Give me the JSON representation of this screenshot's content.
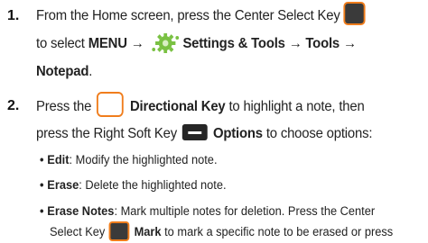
{
  "steps": [
    {
      "number": "1.",
      "line1_text": "From the Home screen, press the Center Select Key",
      "line2_pre": "to select ",
      "menu": "MENU",
      "arrow": "→",
      "settings_tools": "Settings & Tools",
      "tools": "Tools",
      "notepad": "Notepad",
      "period": "."
    },
    {
      "number": "2.",
      "press_the": "Press the",
      "directional_key": "Directional Key",
      "to_highlight": " to highlight a note, then",
      "press_right_soft_key": "press the Right Soft Key",
      "options": "Options",
      "to_choose": " to choose options:"
    }
  ],
  "bullets": [
    {
      "term": "Edit",
      "desc": ": Modify the highlighted note."
    },
    {
      "term": "Erase",
      "desc": ": Delete the highlighted note."
    },
    {
      "term": "Erase Notes",
      "desc": ": Mark multiple notes for deletion. Press the Center",
      "cont_pre": "Select Key",
      "cont_bold": "Mark",
      "cont_post": " to mark a specific note to be erased or press"
    }
  ],
  "icons": {
    "center_select_key": "center-select-key-icon",
    "settings_gear": "settings-gear-icon",
    "directional_key": "directional-key-icon",
    "right_soft_key": "right-soft-key-icon"
  },
  "colors": {
    "key_outline": "#f07d1c",
    "key_fill": "#3a3a3a",
    "gear": "#7ac143"
  }
}
